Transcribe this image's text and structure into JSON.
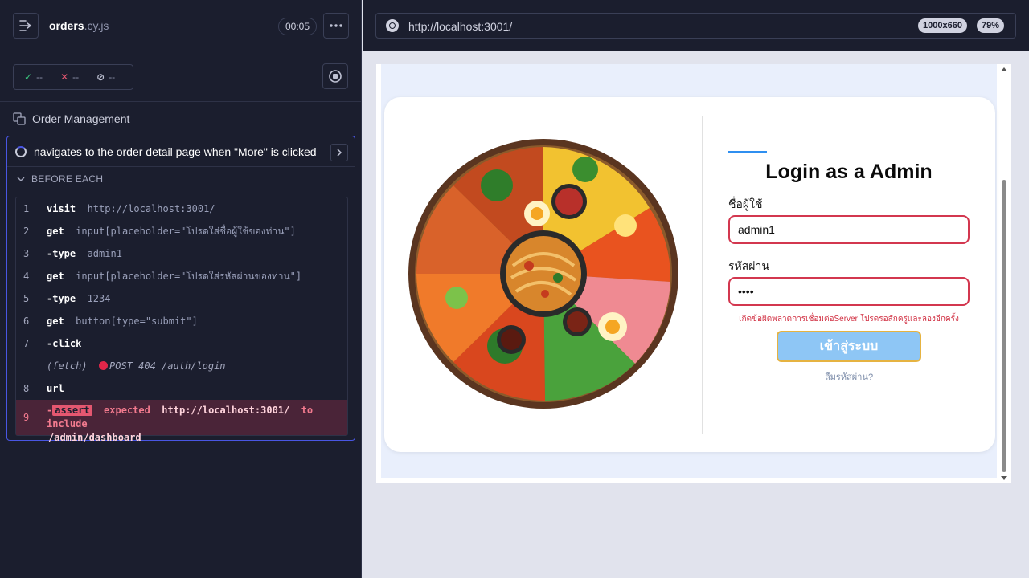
{
  "reporter": {
    "spec_name": "orders",
    "spec_ext": ".cy.js",
    "timer": "00:05",
    "more_icon": "ellipsis-icon",
    "stats": {
      "passed": "--",
      "failed": "--",
      "pending": "--"
    },
    "suite_title": "Order Management",
    "test_title": "navigates to the order detail page when \"More\" is clicked",
    "hook_label": "BEFORE EACH",
    "commands": [
      {
        "num": "1",
        "name": "visit",
        "arg": "http://localhost:3001/"
      },
      {
        "num": "2",
        "name": "get",
        "arg": "input[placeholder=\"โปรดใส่ชื่อผู้ใช้ของท่าน\"]"
      },
      {
        "num": "3",
        "name": "-type",
        "arg": "admin1"
      },
      {
        "num": "4",
        "name": "get",
        "arg": "input[placeholder=\"โปรดใส่รหัสผ่านของท่าน\"]"
      },
      {
        "num": "5",
        "name": "-type",
        "arg": "1234"
      },
      {
        "num": "6",
        "name": "get",
        "arg": "button[type=\"submit\"]"
      },
      {
        "num": "7",
        "name": "-click",
        "arg": ""
      },
      {
        "num": "",
        "name": "(fetch)",
        "arg": "POST 404 /auth/login"
      },
      {
        "num": "8",
        "name": "url",
        "arg": ""
      }
    ],
    "error_cmd": {
      "num": "9",
      "dash": "-",
      "badge": "assert",
      "expected": "expected",
      "url": "http://localhost:3001/",
      "to_include": "to include",
      "path": "/admin/dashboard"
    }
  },
  "aut": {
    "url": "http://localhost:3001/",
    "viewport": "1000x660",
    "zoom": "79%"
  },
  "login_page": {
    "title": "Login as a Admin",
    "username_label": "ชื่อผู้ใช้",
    "username_value": "admin1",
    "password_label": "รหัสผ่าน",
    "password_value": "••••",
    "error": "เกิดข้อผิดพลาดการเชื่อมต่อServer โปรดรอสักครู่และลองอีกครั้ง",
    "submit_label": "เข้าสู่ระบบ",
    "forgot_label": "ลืมรหัสผ่าน?"
  },
  "colors": {
    "accent": "#4956e3",
    "error_red": "#d3374f",
    "submit_bg": "#8ec6f5"
  }
}
